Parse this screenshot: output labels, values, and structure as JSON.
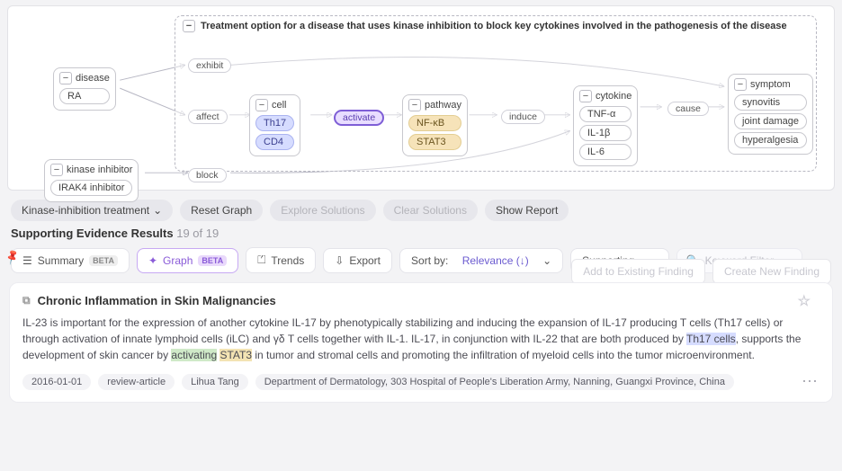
{
  "graph": {
    "main_container": "Treatment option for a disease that uses kinase inhibition to block key cytokines involved in the pathogenesis of the disease",
    "nodes": {
      "disease": {
        "label": "disease",
        "chips": [
          "RA"
        ]
      },
      "kinase_inhibitor": {
        "label": "kinase inhibitor",
        "chips": [
          "IRAK4 inhibitor"
        ]
      },
      "cell": {
        "label": "cell",
        "chips": [
          "Th17",
          "CD4"
        ]
      },
      "pathway": {
        "label": "pathway",
        "chips": [
          "NF-κB",
          "STAT3"
        ]
      },
      "cytokine": {
        "label": "cytokine",
        "chips": [
          "TNF-α",
          "IL-1β",
          "IL-6"
        ]
      },
      "symptom": {
        "label": "symptom",
        "chips": [
          "synovitis",
          "joint damage",
          "hyperalgesia"
        ]
      }
    },
    "edges": {
      "exhibit": "exhibit",
      "affect": "affect",
      "block": "block",
      "activate": "activate",
      "induce": "induce",
      "cause": "cause"
    }
  },
  "toolbar": {
    "dropdown": "Kinase-inhibition treatment",
    "reset": "Reset Graph",
    "explore": "Explore Solutions",
    "clear": "Clear Solutions",
    "report": "Show Report"
  },
  "evidence": {
    "title": "Supporting Evidence Results",
    "count": "19 of 19",
    "add": "Add to Existing Finding",
    "create": "Create New Finding"
  },
  "tabs": {
    "summary": "Summary",
    "graph": "Graph",
    "trends": "Trends",
    "export": "Export",
    "sort_prefix": "Sort by:",
    "sort_value": "Relevance (↓)",
    "supporting": "Supporting",
    "filter_placeholder": "Keyword Filter",
    "beta": "BETA"
  },
  "result": {
    "title": "Chronic Inflammation in Skin Malignancies",
    "body_parts": {
      "p1": "IL-23 is important for the expression of another cytokine IL-17 by phenotypically stabilizing and inducing the expansion of IL-17 producing T cells (Th17 cells) or through activation of innate lymphoid cells (iLC) and γδ T cells together with IL-1. IL-17, in conjunction with IL-22 that are both produced by ",
      "h1": "Th17 cells",
      "p2": ", supports the development of skin cancer by ",
      "h2": "activating",
      "p3": " ",
      "h3": "STAT3",
      "p4": " in tumor and stromal cells and promoting the infiltration of myeloid cells into the tumor microenvironment."
    },
    "meta": [
      "2016-01-01",
      "review-article",
      "Lihua Tang",
      "Department of Dermatology, 303 Hospital of People's Liberation Army, Nanning, Guangxi Province, China"
    ]
  },
  "collapse_glyph": "−"
}
